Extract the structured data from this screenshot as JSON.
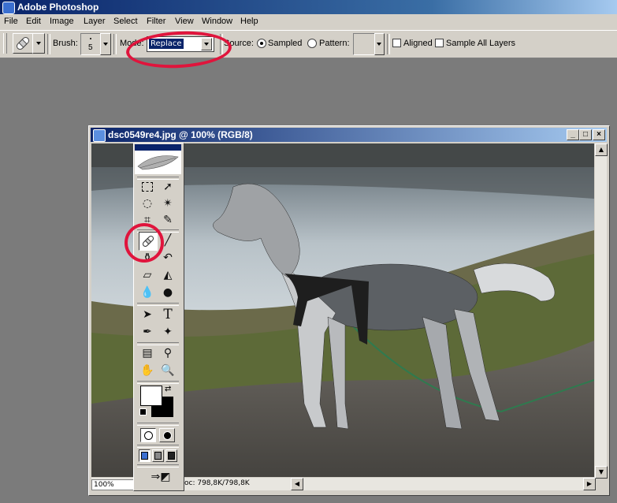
{
  "app": {
    "title": "Adobe Photoshop"
  },
  "menu": [
    "File",
    "Edit",
    "Image",
    "Layer",
    "Select",
    "Filter",
    "View",
    "Window",
    "Help"
  ],
  "options": {
    "brush_label": "Brush:",
    "brush_size": "5",
    "mode_label": "Mode:",
    "mode_value": "Replace",
    "source_label": "Source:",
    "sampled_label": "Sampled",
    "pattern_label": "Pattern:",
    "aligned_label": "Aligned",
    "sample_all_layers_label": "Sample All Layers",
    "source_selected": "Sampled",
    "aligned_checked": false,
    "sample_all_layers_checked": false
  },
  "document": {
    "title": "dsc0549re4.jpg @ 100% (RGB/8)",
    "zoom": "100%",
    "doc_info": "oc: 798,8K/798,8K",
    "minimize": "_",
    "maximize": "□",
    "close": "×"
  },
  "toolbox": {
    "active_tool": "healing-brush",
    "tools": [
      "marquee",
      "move",
      "lasso",
      "magic-wand",
      "crop",
      "slice",
      "healing-brush",
      "brush",
      "clone-stamp",
      "history-brush",
      "eraser",
      "paint-bucket",
      "blur",
      "dodge",
      "path-selection",
      "type",
      "pen",
      "custom-shape",
      "notes",
      "eyedropper",
      "hand",
      "zoom"
    ],
    "type_glyph": "T"
  },
  "colors": {
    "annotation": "#e0143c",
    "titlebar": "#0a246a",
    "chrome": "#d4d0c8"
  }
}
